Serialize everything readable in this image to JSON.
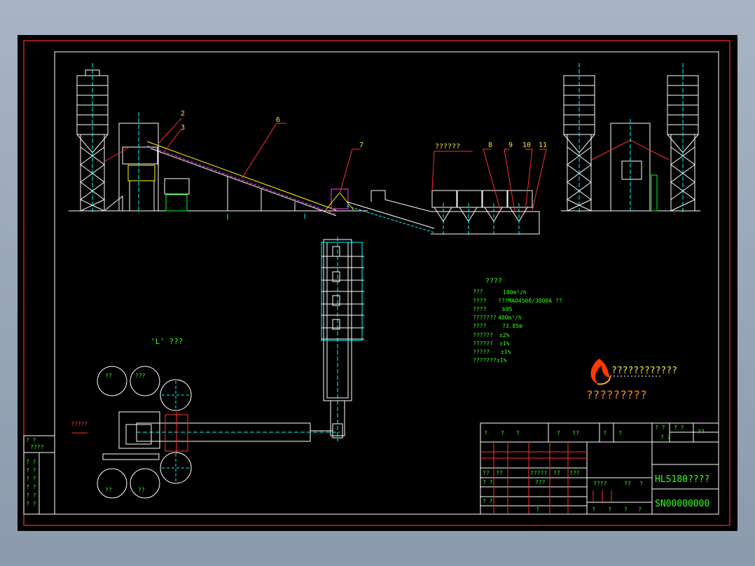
{
  "callouts": [
    "2",
    "3",
    "6",
    "7",
    "8",
    "9",
    "10",
    "11"
  ],
  "labels": {
    "aggregate_bins": "??????",
    "layout_title": "'L' ???",
    "entrance": "?????"
  },
  "specs": {
    "heading": "????",
    "rows": [
      {
        "k": "???",
        "v": "180m³/h"
      },
      {
        "k": "????",
        "v": "???MAO4500/3000A ??"
      },
      {
        "k": "????",
        "v": "b05"
      },
      {
        "k": "???????",
        "v": "400m³/h"
      },
      {
        "k": "????",
        "v": "?3.85m"
      },
      {
        "k": "??????",
        "v": "±2%"
      },
      {
        "k": "??????",
        "v": "±1%"
      },
      {
        "k": "?????",
        "v": "±1%"
      },
      {
        "k": "???????",
        "v": "±1%"
      }
    ]
  },
  "logo": {
    "company": "????????????",
    "slogan": "?????????"
  },
  "title_block": {
    "model": "HLS180????",
    "drawing_no": "SN00000000",
    "cells": [
      "?",
      "?",
      "?",
      "?",
      "??",
      "?",
      "?",
      "? ?",
      "? ?",
      "? ?",
      "??",
      "??",
      "??",
      "?????",
      "??",
      "???",
      "? ?",
      "???",
      "????",
      "??",
      "?",
      "? ?",
      "?",
      "?",
      "?",
      "?",
      "?"
    ]
  },
  "left_block": {
    "cells": [
      "? ?",
      "????",
      "? ?",
      "? ?",
      "? ?",
      "? ?",
      "? ?",
      "? ?"
    ]
  },
  "tanks": [
    "??",
    "???",
    "??",
    "??"
  ]
}
